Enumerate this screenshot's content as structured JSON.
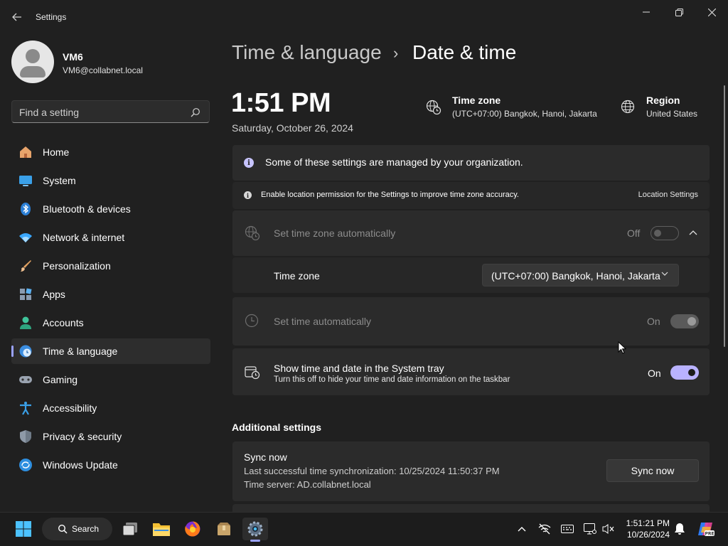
{
  "window": {
    "title": "Settings",
    "controls": {
      "minimize": "—",
      "maximize": "❐",
      "close": "✕"
    }
  },
  "profile": {
    "name": "VM6",
    "email": "VM6@collabnet.local"
  },
  "search": {
    "placeholder": "Find a setting"
  },
  "sidebar": {
    "items": [
      {
        "label": "Home",
        "icon": "home-icon"
      },
      {
        "label": "System",
        "icon": "system-icon"
      },
      {
        "label": "Bluetooth & devices",
        "icon": "bluetooth-icon"
      },
      {
        "label": "Network & internet",
        "icon": "network-icon"
      },
      {
        "label": "Personalization",
        "icon": "personalization-icon"
      },
      {
        "label": "Apps",
        "icon": "apps-icon"
      },
      {
        "label": "Accounts",
        "icon": "accounts-icon"
      },
      {
        "label": "Time & language",
        "icon": "time-language-icon",
        "active": true
      },
      {
        "label": "Gaming",
        "icon": "gaming-icon"
      },
      {
        "label": "Accessibility",
        "icon": "accessibility-icon"
      },
      {
        "label": "Privacy & security",
        "icon": "privacy-icon"
      },
      {
        "label": "Windows Update",
        "icon": "windows-update-icon"
      }
    ]
  },
  "header": {
    "parent": "Time & language",
    "separator": "›",
    "current": "Date & time"
  },
  "summary": {
    "time": "1:51 PM",
    "date": "Saturday, October 26, 2024",
    "timezone_label": "Time zone",
    "timezone_value": "(UTC+07:00) Bangkok, Hanoi, Jakarta",
    "region_label": "Region",
    "region_value": "United States"
  },
  "notices": {
    "managed": "Some of these settings are managed by your organization.",
    "location": "Enable location permission for the Settings to improve time zone accuracy.",
    "location_link": "Location Settings"
  },
  "settings": {
    "auto_timezone": {
      "label": "Set time zone automatically",
      "state": "Off",
      "enabled": false
    },
    "timezone": {
      "label": "Time zone",
      "value": "(UTC+07:00) Bangkok, Hanoi, Jakarta"
    },
    "auto_time": {
      "label": "Set time automatically",
      "state": "On",
      "enabled": false
    },
    "tray": {
      "label": "Show time and date in the System tray",
      "description": "Turn this off to hide your time and date information on the taskbar",
      "state": "On"
    }
  },
  "additional": {
    "title": "Additional settings",
    "sync_title": "Sync now",
    "last_sync": "Last successful time synchronization: 10/25/2024 11:50:37 PM",
    "server": "Time server: AD.collabnet.local",
    "sync_button": "Sync now"
  },
  "taskbar": {
    "search_label": "Search",
    "clock_time": "1:51:21 PM",
    "clock_date": "10/26/2024",
    "chevron": "^"
  },
  "colors": {
    "accent": "#b9b2ff",
    "background": "#202020",
    "card": "#2b2b2b"
  }
}
